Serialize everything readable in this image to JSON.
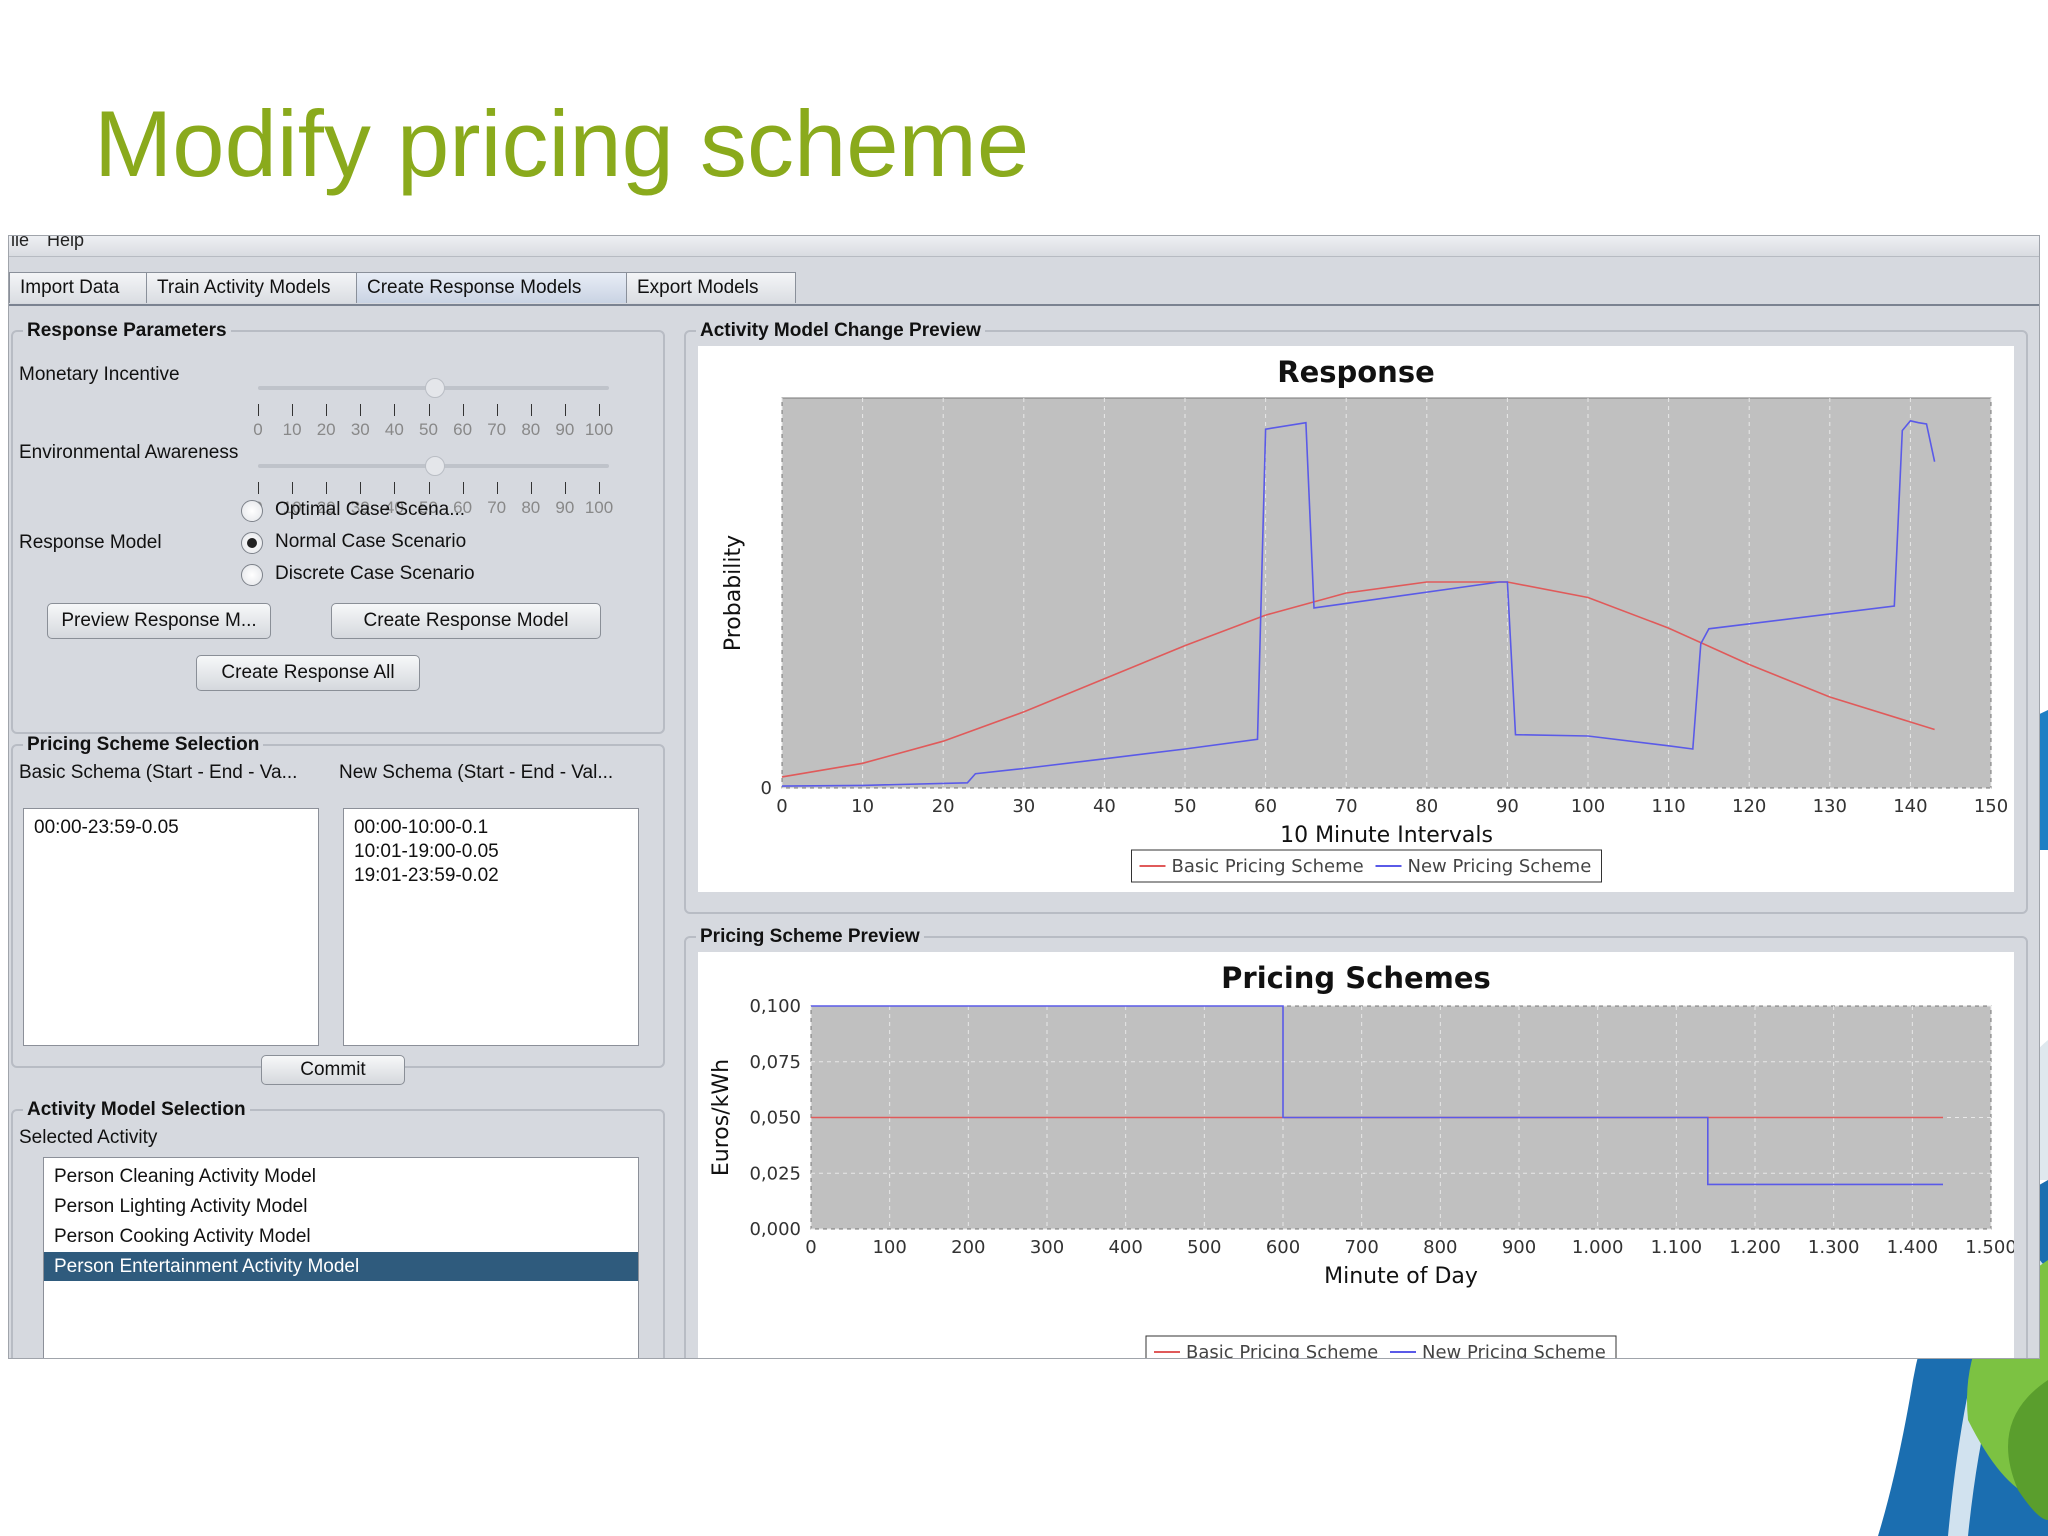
{
  "slide": {
    "title": "Modify pricing scheme"
  },
  "menu": {
    "file": "ile",
    "help": "Help"
  },
  "tabs": [
    "Import Data",
    "Train Activity Models",
    "Create Response Models",
    "Export Models"
  ],
  "active_tab": "Create Response Models",
  "response_parameters": {
    "title": "Response Parameters",
    "monetary_label": "Monetary Incentive",
    "monetary_value": 50,
    "environmental_label": "Environmental Awareness",
    "environmental_value": 50,
    "ticks": [
      "0",
      "10",
      "20",
      "30",
      "40",
      "50",
      "60",
      "70",
      "80",
      "90",
      "100"
    ],
    "response_model_label": "Response Model",
    "options": [
      "Optimal Case Scena...",
      "Normal Case Scenario",
      "Discrete Case Scenario"
    ],
    "selected_option": "Normal Case Scenario",
    "preview_button": "Preview Response M...",
    "create_button": "Create Response Model",
    "create_all_button": "Create Response All"
  },
  "pricing_selection": {
    "title": "Pricing Scheme Selection",
    "basic_label": "Basic Schema (Start - End - Va...",
    "new_label": "New Schema (Start - End - Val...",
    "basic_entries": [
      "00:00-23:59-0.05"
    ],
    "new_entries": [
      "00:00-10:00-0.1",
      "10:01-19:00-0.05",
      "19:01-23:59-0.02"
    ],
    "commit_button": "Commit"
  },
  "activity_selection": {
    "title": "Activity Model Selection",
    "selected_label": "Selected Activity",
    "items": [
      "Person Cleaning Activity Model",
      "Person Lighting Activity Model",
      "Person Cooking Activity Model",
      "Person Entertainment Activity Model"
    ],
    "selected_item": "Person Entertainment Activity Model"
  },
  "preview_panels": {
    "activity_title": "Activity Model Change Preview",
    "pricing_title": "Pricing Scheme Preview"
  },
  "chart_data": [
    {
      "type": "line",
      "title": "Response",
      "xlabel": "10 Minute Intervals",
      "ylabel": "Probability",
      "xlim": [
        0,
        150
      ],
      "xticks": [
        "0",
        "10",
        "20",
        "30",
        "40",
        "50",
        "60",
        "70",
        "80",
        "90",
        "100",
        "110",
        "120",
        "130",
        "140",
        "150"
      ],
      "yticks": [
        "0"
      ],
      "grid": true,
      "legend": "bottom",
      "series": [
        {
          "name": "Basic Pricing Scheme",
          "color": "#e05a5a",
          "x": [
            0,
            10,
            20,
            30,
            40,
            50,
            60,
            70,
            80,
            90,
            100,
            110,
            120,
            130,
            143
          ],
          "y": [
            0.017,
            0.038,
            0.072,
            0.117,
            0.168,
            0.219,
            0.266,
            0.3,
            0.317,
            0.317,
            0.293,
            0.246,
            0.19,
            0.14,
            0.09
          ]
        },
        {
          "name": "New Pricing Scheme",
          "color": "#5a5ae8",
          "x": [
            0,
            10,
            23,
            24,
            30,
            40,
            50,
            59,
            60,
            65,
            66,
            89,
            90,
            91,
            100,
            110,
            113,
            114,
            115,
            138,
            139,
            140,
            141,
            142,
            143
          ],
          "y": [
            0.003,
            0.004,
            0.008,
            0.022,
            0.03,
            0.045,
            0.06,
            0.075,
            0.552,
            0.562,
            0.277,
            0.317,
            0.317,
            0.082,
            0.08,
            0.065,
            0.06,
            0.222,
            0.245,
            0.28,
            0.55,
            0.565,
            0.562,
            0.56,
            0.502
          ]
        }
      ]
    },
    {
      "type": "line",
      "title": "Pricing Schemes",
      "xlabel": "Minute of Day",
      "ylabel": "Euros/kWh",
      "xlim": [
        0,
        1500
      ],
      "ylim": [
        0,
        0.1
      ],
      "xticks": [
        "0",
        "100",
        "200",
        "300",
        "400",
        "500",
        "600",
        "700",
        "800",
        "900",
        "1.000",
        "1.100",
        "1.200",
        "1.300",
        "1.400",
        "1.500"
      ],
      "yticks": [
        "0,000",
        "0,025",
        "0,050",
        "0,075",
        "0,100"
      ],
      "grid": true,
      "legend": "bottom",
      "series": [
        {
          "name": "Basic Pricing Scheme",
          "color": "#e05a5a",
          "x": [
            0,
            1439
          ],
          "y": [
            0.05,
            0.05
          ]
        },
        {
          "name": "New Pricing Scheme",
          "color": "#5a5ae8",
          "x": [
            0,
            600,
            600,
            1140,
            1140,
            1439
          ],
          "y": [
            0.1,
            0.1,
            0.05,
            0.05,
            0.02,
            0.02
          ]
        }
      ]
    }
  ]
}
